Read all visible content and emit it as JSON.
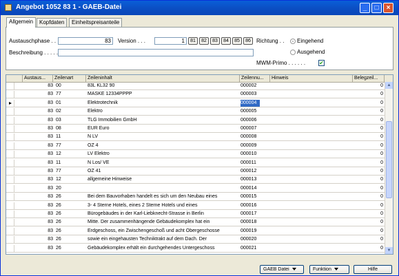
{
  "window": {
    "title": "Angebot 1052 83 1 - GAEB-Datei"
  },
  "tabs": [
    {
      "label": "Allgemein"
    },
    {
      "label": "Kopfdaten"
    },
    {
      "label": "Einheitspreisanteile"
    }
  ],
  "form": {
    "austauschphase_label": "Austauschphase . . . .",
    "austauschphase_value": "83",
    "version_label": "Version . . .",
    "version_value": "1",
    "version_buttons": [
      "81",
      "82",
      "83",
      "84",
      "85",
      "86"
    ],
    "beschreibung_label": "Beschreibung . . . . . .",
    "beschreibung_value": "",
    "richtung_label": "Richtung . .",
    "eingehend_label": "Eingehend",
    "ausgehend_label": "Ausgehend",
    "mwm_label": "MWM-Primo . . . . . .",
    "mwm_checked": "✔"
  },
  "table": {
    "headers": [
      "Austaus...",
      "Zeilenart",
      "Zeileninhalt",
      "Zeilennu...",
      "Hinweis",
      "Belegzeil..."
    ],
    "rows": [
      {
        "a": "83",
        "art": "00",
        "inhalt": "83L           KL32                    90",
        "nr": "000002",
        "beleg": "0"
      },
      {
        "a": "83",
        "art": "77",
        "inhalt": "MASKE          12334PPPP",
        "nr": "000003",
        "beleg": "0"
      },
      {
        "a": "83",
        "art": "01",
        "inhalt": "Elektrotechnik",
        "nr": "000004",
        "beleg": "0"
      },
      {
        "a": "83",
        "art": "02",
        "inhalt": "Elektro",
        "nr": "000005",
        "beleg": "0"
      },
      {
        "a": "83",
        "art": "03",
        "inhalt": "TLG Immobilien GmbH",
        "nr": "000006",
        "beleg": "0"
      },
      {
        "a": "83",
        "art": "08",
        "inhalt": "EUR  Euro",
        "nr": "000007",
        "beleg": "0"
      },
      {
        "a": "83",
        "art": "11",
        "inhalt": "    N   LV",
        "nr": "000008",
        "beleg": "0"
      },
      {
        "a": "83",
        "art": "77",
        "inhalt": "OZ          4",
        "nr": "000009",
        "beleg": "0"
      },
      {
        "a": "83",
        "art": "12",
        "inhalt": "LV Elektro",
        "nr": "000010",
        "beleg": "0"
      },
      {
        "a": "83",
        "art": "11",
        "inhalt": "    N   Los/ VE",
        "nr": "000011",
        "beleg": "0"
      },
      {
        "a": "83",
        "art": "77",
        "inhalt": "OZ          41",
        "nr": "000012",
        "beleg": "0"
      },
      {
        "a": "83",
        "art": "12",
        "inhalt": "allgemeine Hinweise",
        "nr": "000013",
        "beleg": "0"
      },
      {
        "a": "83",
        "art": "20",
        "inhalt": "",
        "nr": "000014",
        "beleg": "0"
      },
      {
        "a": "83",
        "art": "26",
        "inhalt": "Bei dem Bauvorhaben handelt es sich um den Neubau eines",
        "nr": "000015",
        "beleg": "0"
      },
      {
        "a": "83",
        "art": "26",
        "inhalt": "3- 4 Sterne Hotels, eines 2 Sterne Hotels und eines",
        "nr": "000016",
        "beleg": "0"
      },
      {
        "a": "83",
        "art": "26",
        "inhalt": "Bürogebäudes in der Karl-Liebknecht-Strasse in Berlin",
        "nr": "000017",
        "beleg": "0"
      },
      {
        "a": "83",
        "art": "26",
        "inhalt": "Mitte. Der zusammenhängende Gebäudekomplex hat ein",
        "nr": "000018",
        "beleg": "0"
      },
      {
        "a": "83",
        "art": "26",
        "inhalt": "Erdgeschoss, ein Zwischengeschoß und acht Obergeschosse",
        "nr": "000019",
        "beleg": "0"
      },
      {
        "a": "83",
        "art": "26",
        "inhalt": "sowie ein eingehausten Techniktrakt auf dem Dach. Der",
        "nr": "000020",
        "beleg": "0"
      },
      {
        "a": "83",
        "art": "26",
        "inhalt": "Gebäudekomplex erhält ein durchgehendes Untergeschoss",
        "nr": "000021",
        "beleg": "0"
      }
    ]
  },
  "footer": {
    "gaeb_label": "GAEB Datei",
    "funktion_label": "Funktion",
    "hilfe_label": "Hilfe"
  },
  "colors": {
    "titlebar": "#0b4fc4",
    "selection": "#316ac5",
    "window_bg": "#ece9d8"
  }
}
